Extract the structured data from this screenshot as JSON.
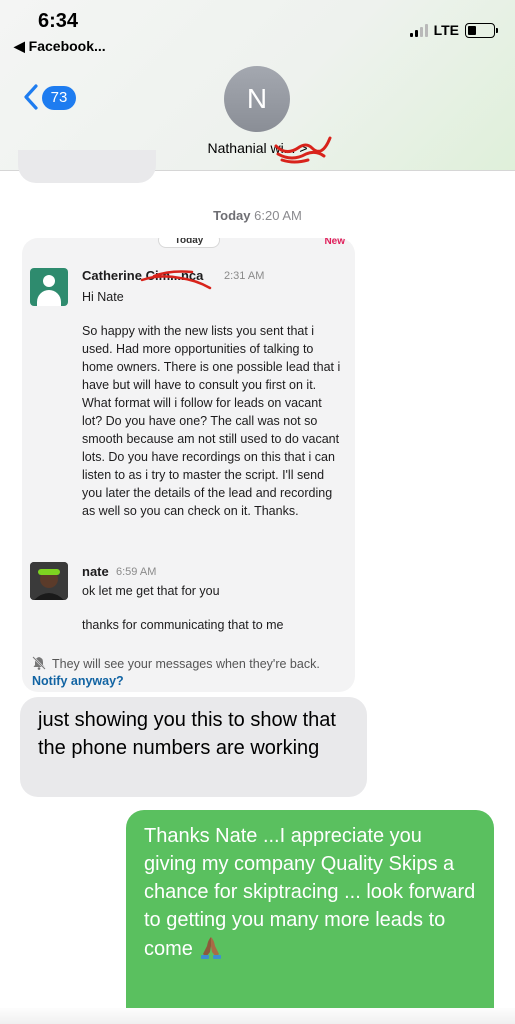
{
  "status_bar": {
    "time": "6:34",
    "back_app": "◀ Facebook...",
    "network": "LTE",
    "battery_level": 0.35
  },
  "header": {
    "unread_count": "73",
    "avatar_initial": "N",
    "contact_name": "Nathanial wi... >"
  },
  "thread": {
    "timestamp_day": "Today",
    "timestamp_time": "6:20 AM"
  },
  "slack": {
    "date_pill": "Today",
    "new_label": "New",
    "msg1": {
      "sender": "Catherine Cim...nca",
      "time": "2:31 AM",
      "greeting": "Hi Nate",
      "text": "So happy with the new lists you sent that i used. Had more opportunities of talking to home owners. There is one possible lead that i have but will have to consult you first on it. What format will i follow for leads on vacant lot? Do you have one? The call was not so smooth because am not still used to do vacant lots. Do you have recordings on this that i can listen to as i try to master the script. I'll send you later the details of the lead and recording as well so you can check on it. Thanks."
    },
    "msg2": {
      "sender": "nate",
      "time": "6:59 AM",
      "line1": "ok let me get that for you",
      "line2": "thanks for communicating that to me"
    },
    "footer_text": "They will see your messages when they're back.",
    "footer_link": "Notify anyway?"
  },
  "bubbles": {
    "incoming": "just showing you this to show that the phone numbers are working",
    "outgoing": "Thanks Nate ...I  appreciate you giving my company Quality Skips a chance for skiptracing ... look forward to getting you many more leads to come"
  },
  "colors": {
    "imessage_blue": "#1e7cf0",
    "outgoing_green": "#5ac05f",
    "incoming_gray": "#e9e9eb",
    "slack_link": "#1264a3",
    "scribble_red": "#d8231b"
  }
}
